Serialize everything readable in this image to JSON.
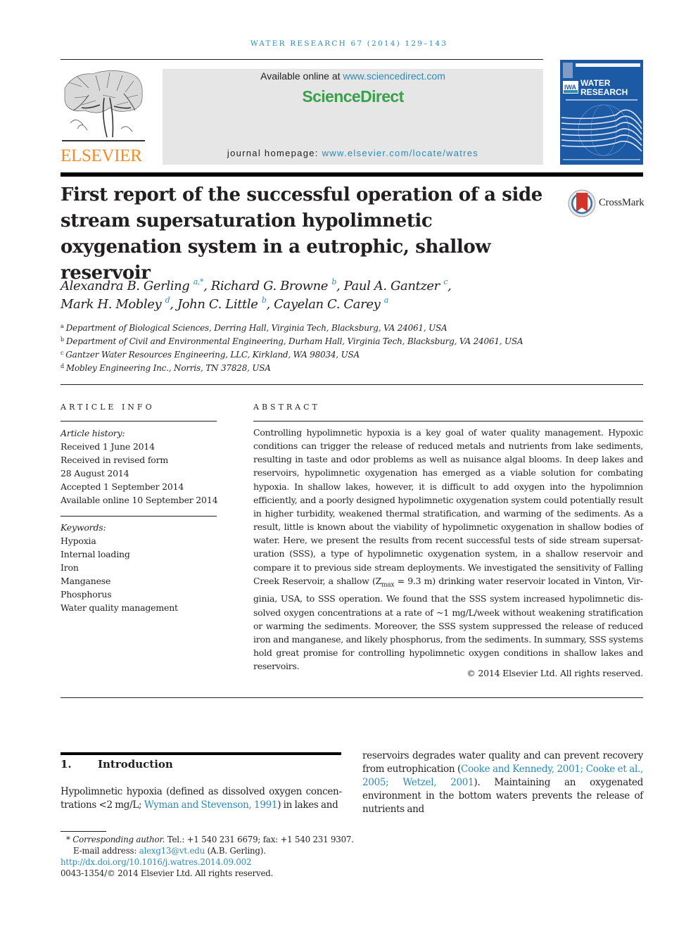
{
  "running_head": "WATER RESEARCH 67 (2014) 129–143",
  "publisher": {
    "logo_word": "ELSEVIER",
    "logo_color": "#f28c28"
  },
  "sciencedirect": {
    "available_prefix": "Available online at ",
    "available_link": "www.sciencedirect.com",
    "brand": "ScienceDirect",
    "brand_color": "#3aa14a",
    "homepage_prefix": "journal homepage: ",
    "homepage_link": "www.elsevier.com/locate/watres"
  },
  "journal_cover": {
    "line1": "WATER",
    "line2": "RESEARCH",
    "badge": "IWA",
    "color": "#1d5aa6"
  },
  "title": "First report of the successful operation of a side stream supersaturation hypolimnetic oxygenation system in a eutrophic, shallow reservoir",
  "crossmark_label": "CrossMark",
  "authors": [
    {
      "name": "Alexandra B. Gerling",
      "sup": "a,*",
      "sep": ", "
    },
    {
      "name": "Richard G. Browne",
      "sup": "b",
      "sep": ", "
    },
    {
      "name": "Paul A. Gantzer",
      "sup": "c",
      "sep": ","
    },
    {
      "name": "Mark H. Mobley",
      "sup": "d",
      "sep": ", "
    },
    {
      "name": "John C. Little",
      "sup": "b",
      "sep": ", "
    },
    {
      "name": "Cayelan C. Carey",
      "sup": "a",
      "sep": ""
    }
  ],
  "affiliations": [
    {
      "key": "a",
      "text": "Department of Biological Sciences, Derring Hall, Virginia Tech, Blacksburg, VA 24061, USA"
    },
    {
      "key": "b",
      "text": "Department of Civil and Environmental Engineering, Durham Hall, Virginia Tech, Blacksburg, VA 24061, USA"
    },
    {
      "key": "c",
      "text": "Gantzer Water Resources Engineering, LLC, Kirkland, WA 98034, USA"
    },
    {
      "key": "d",
      "text": "Mobley Engineering Inc., Norris, TN 37828, USA"
    }
  ],
  "article_info": {
    "heading": "ARTICLE INFO",
    "history_label": "Article history:",
    "history": [
      "Received 1 June 2014",
      "Received in revised form",
      "28 August 2014",
      "Accepted 1 September 2014",
      "Available online 10 September 2014"
    ],
    "keywords_label": "Keywords:",
    "keywords": [
      "Hypoxia",
      "Internal loading",
      "Iron",
      "Manganese",
      "Phosphorus",
      "Water quality management"
    ]
  },
  "abstract": {
    "heading": "ABSTRACT",
    "part1": "Controlling hypolimnetic hypoxia is a key goal of water quality management. Hypoxic conditions can trigger the release of reduced metals and nutrients from lake sediments, resulting in taste and odor problems as well as nuisance algal blooms. In deep lakes and reservoirs, hypolimnetic oxygenation has emerged as a viable solution for combating hypoxia. In shallow lakes, however, it is difficult to add oxygen into the hypolimnion efficiently, and a poorly designed hypolimnetic oxygenation system could potentially result in higher turbidity, weakened thermal stratification, and warming of the sediments. As a result, little is known about the viability of hypolimnetic oxygenation in shallow bodies of water. Here, we present the results from recent successful tests of side stream supersat­uration (SSS), a type of hypolimnetic oxygenation system, in a shallow reservoir and compare it to previous side stream deployments. We investigated the sensitivity of Falling Creek Reservoir, a shallow (",
    "zmax_var": "Z",
    "zmax_sub": "max",
    "zmax_value": " = 9.3 m",
    "part2": ") drinking water reservoir located in Vinton, Vir­ginia, USA, to SSS operation. We found that the SSS system increased hypolimnetic dis­solved oxygen concentrations at a rate of ~1 mg/L/week without weakening stratification or warming the sediments. Moreover, the SSS system suppressed the release of reduced iron and manganese, and likely phosphorus, from the sediments. In summary, SSS sys­tems hold great promise for controlling hypolimnetic oxygen conditions in shallow lakes and reservoirs.",
    "copyright": "© 2014 Elsevier Ltd. All rights reserved."
  },
  "introduction": {
    "number": "1.",
    "heading": "Introduction",
    "col1_text1": "Hypolimnetic hypoxia (defined as dissolved oxygen concen­trations <2 mg/L; ",
    "col1_cite": "Wyman and Stevenson, 1991",
    "col1_text2": ") in lakes and",
    "col2_text1": "reservoirs degrades water quality and can prevent recovery from eutrophication (",
    "col2_cite": "Cooke and Kennedy, 2001; Cooke et al., 2005; Wetzel, 2001",
    "col2_text2": "). Maintaining an oxygenated environment in the bottom waters prevents the release of nutrients and"
  },
  "footnotes": {
    "star": "*",
    "corresponding_label": "Corresponding author.",
    "contact": " Tel.: +1 540 231 6679; fax: +1 540 231 9307.",
    "email_label": "E-mail address: ",
    "email": "alexg13@vt.edu",
    "email_suffix": " (A.B. Gerling).",
    "doi": "http://dx.doi.org/10.1016/j.watres.2014.09.002",
    "issn_copyright": "0043-1354/© 2014 Elsevier Ltd. All rights reserved."
  },
  "colors": {
    "link": "#2a8ab7",
    "text": "#231f20",
    "header_box": "#e6e6e6"
  }
}
